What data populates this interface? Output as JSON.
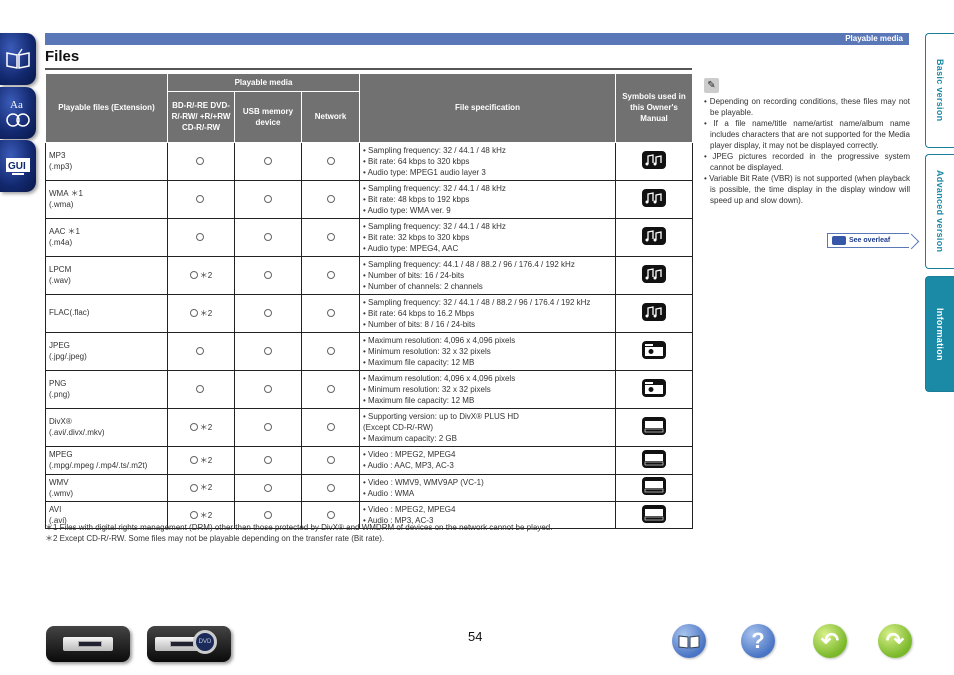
{
  "header": {
    "section": "Playable media",
    "title": "Files"
  },
  "left_nav": [
    {
      "name": "contents",
      "icon": "book-icon"
    },
    {
      "name": "index",
      "icon": "index-icon"
    },
    {
      "name": "gui",
      "icon": "gui-icon",
      "label": "GUI"
    }
  ],
  "table": {
    "headers": {
      "playable_files": "Playable files (Extension)",
      "playable_media": "Playable media",
      "disc": "BD-R/-RE DVD-R/-RW/ +R/+RW CD-R/-RW",
      "usb": "USB memory device",
      "network": "Network",
      "spec": "File specification",
      "symbols": "Symbols used in this Owner's Manual"
    },
    "rows": [
      {
        "name": "MP3",
        "note": "",
        "ext": "(.mp3)",
        "disc": "○",
        "disc_note": "",
        "usb": "○",
        "network": "○",
        "spec": [
          "• Sampling frequency: 32 / 44.1 / 48 kHz",
          "• Bit rate: 64 kbps to 320 kbps",
          "• Audio type: MPEG1 audio layer 3"
        ],
        "symbol": "music-icon"
      },
      {
        "name": "WMA",
        "note": "＊1",
        "ext": "(.wma)",
        "disc": "○",
        "disc_note": "",
        "usb": "○",
        "network": "○",
        "spec": [
          "• Sampling frequency: 32 / 44.1 / 48 kHz",
          "• Bit rate: 48 kbps to 192 kbps",
          "• Audio type: WMA ver. 9"
        ],
        "symbol": "music-icon"
      },
      {
        "name": "AAC",
        "note": "＊1",
        "ext": "(.m4a)",
        "disc": "○",
        "disc_note": "",
        "usb": "○",
        "network": "○",
        "spec": [
          "• Sampling frequency: 32 / 44.1 / 48 kHz",
          "• Bit rate: 32 kbps to 320 kbps",
          "• Audio type: MPEG4, AAC"
        ],
        "symbol": "music-icon"
      },
      {
        "name": "LPCM",
        "note": "",
        "ext": "(.wav)",
        "disc": "○",
        "disc_note": "＊2",
        "usb": "○",
        "network": "○",
        "spec": [
          "• Sampling frequency: 44.1 / 48 / 88.2 / 96 / 176.4 / 192 kHz",
          "• Number of bits: 16 / 24-bits",
          "• Number of channels: 2 channels"
        ],
        "symbol": "music-icon"
      },
      {
        "name": "FLAC(.flac)",
        "note": "",
        "ext": "",
        "disc": "○",
        "disc_note": "＊2",
        "usb": "○",
        "network": "○",
        "spec": [
          "• Sampling frequency: 32 / 44.1 / 48 / 88.2 / 96 / 176.4 / 192 kHz",
          "• Bit rate: 64 kbps to 16.2 Mbps",
          "• Number of bits: 8 / 16 / 24-bits"
        ],
        "symbol": "music-icon"
      },
      {
        "name": "JPEG",
        "note": "",
        "ext": "(.jpg/.jpeg)",
        "disc": "○",
        "disc_note": "",
        "usb": "○",
        "network": "○",
        "spec": [
          "• Maximum resolution: 4,096 x 4,096 pixels",
          "• Minimum resolution: 32 x 32 pixels",
          "• Maximum file capacity: 12 MB"
        ],
        "symbol": "photo-icon"
      },
      {
        "name": "PNG",
        "note": "",
        "ext": "(.png)",
        "disc": "○",
        "disc_note": "",
        "usb": "○",
        "network": "○",
        "spec": [
          "• Maximum resolution: 4,096 x 4,096 pixels",
          "• Minimum resolution: 32 x 32 pixels",
          "• Maximum file capacity: 12 MB"
        ],
        "symbol": "photo-icon"
      },
      {
        "name": "DivX®",
        "note": "",
        "ext": "(.avi/.divx/.mkv)",
        "disc": "○",
        "disc_note": "＊2",
        "usb": "○",
        "network": "○",
        "spec": [
          "• Supporting version: up to DivX® PLUS HD",
          "  (Except CD-R/-RW)",
          "• Maximum capacity: 2 GB"
        ],
        "symbol": "video-icon"
      },
      {
        "name": "MPEG",
        "note": "",
        "ext": "(.mpg/.mpeg /.mp4/.ts/.m2t)",
        "disc": "○",
        "disc_note": "＊2",
        "usb": "○",
        "network": "○",
        "spec": [
          "• Video : MPEG2, MPEG4",
          "• Audio : AAC, MP3, AC-3"
        ],
        "symbol": "video-icon"
      },
      {
        "name": "WMV",
        "note": "",
        "ext": "(.wmv)",
        "disc": "○",
        "disc_note": "＊2",
        "usb": "○",
        "network": "○",
        "spec": [
          "• Video : WMV9, WMV9AP (VC-1)",
          "• Audio : WMA"
        ],
        "symbol": "video-icon"
      },
      {
        "name": "AVI",
        "note": "",
        "ext": "(.avi)",
        "disc": "○",
        "disc_note": "＊2",
        "usb": "○",
        "network": "○",
        "spec": [
          "• Video : MPEG2, MPEG4",
          "• Audio : MP3, AC-3"
        ],
        "symbol": "video-icon"
      }
    ]
  },
  "footnotes": [
    "＊1  Files with digital rights management (DRM) other than those protected by DivX® and WMDRM of devices on the network cannot be played.",
    "＊2  Except CD-R/-RW. Some files may not be playable depending on the transfer rate (Bit rate)."
  ],
  "notes": {
    "icon": "pencil-icon",
    "items": [
      "Depending on recording conditions, these files may not be playable.",
      "If a file name/title name/artist name/album name includes characters that are not supported for the Media player display, it may not be displayed correctly.",
      "JPEG pictures recorded in the progressive system cannot be displayed.",
      "Variable Bit Rate (VBR) is not supported (when playback is possible, the time display in the display window will speed up and slow down)."
    ],
    "see_overleaf": "See overleaf"
  },
  "right_tabs": [
    {
      "label": "Basic version",
      "active": false
    },
    {
      "label": "Advanced version",
      "active": false
    },
    {
      "label": "Information",
      "active": true
    }
  ],
  "footer": {
    "page_number": "54",
    "magnifier_label": "DVD"
  },
  "colors": {
    "header_bar": "#5a78b8",
    "table_header": "#717171",
    "tab_accent": "#1a8aa6"
  }
}
